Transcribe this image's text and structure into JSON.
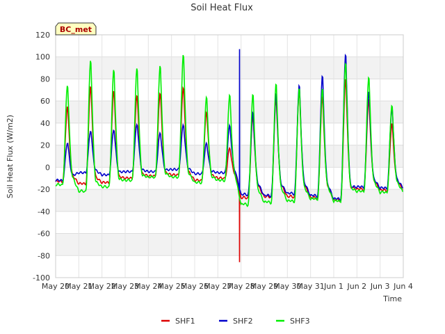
{
  "chart_data": {
    "type": "line",
    "title": "Soil Heat Flux",
    "xlabel": "Time",
    "ylabel": "Soil Heat Flux (W/m2)",
    "badge": "BC_met",
    "ylim": [
      -100,
      120
    ],
    "yticks": [
      -100,
      -80,
      -60,
      -40,
      -20,
      0,
      20,
      40,
      60,
      80,
      100,
      120
    ],
    "xlim": [
      0,
      15
    ],
    "xticks": [
      {
        "v": 0,
        "label": "May 20"
      },
      {
        "v": 1,
        "label": "May 21"
      },
      {
        "v": 2,
        "label": "May 22"
      },
      {
        "v": 3,
        "label": "May 23"
      },
      {
        "v": 4,
        "label": "May 24"
      },
      {
        "v": 5,
        "label": "May 25"
      },
      {
        "v": 6,
        "label": "May 26"
      },
      {
        "v": 7,
        "label": "May 27"
      },
      {
        "v": 8,
        "label": "May 28"
      },
      {
        "v": 9,
        "label": "May 29"
      },
      {
        "v": 10,
        "label": "May 30"
      },
      {
        "v": 11,
        "label": "May 31"
      },
      {
        "v": 12,
        "label": "Jun 1"
      },
      {
        "v": 13,
        "label": "Jun 2"
      },
      {
        "v": 14,
        "label": "Jun 3"
      },
      {
        "v": 15,
        "label": "Jun 4"
      }
    ],
    "grid": true,
    "legend_position": "bottom",
    "series": [
      {
        "name": "SHF1",
        "color": "#dd0000",
        "days": [
          {
            "min": -13,
            "peak": 56
          },
          {
            "min": -15,
            "peak": 75
          },
          {
            "min": -14,
            "peak": 71
          },
          {
            "min": -10,
            "peak": 67
          },
          {
            "min": -8,
            "peak": 69
          },
          {
            "min": -7,
            "peak": 74
          },
          {
            "min": -12,
            "peak": 51
          },
          {
            "min": -10,
            "peak": 18
          },
          {
            "min": -28,
            "peak": 47
          },
          {
            "min": -27,
            "peak": 63
          },
          {
            "min": -27,
            "peak": 71
          },
          {
            "min": -28,
            "peak": 65
          },
          {
            "min": -30,
            "peak": 81
          },
          {
            "min": -20,
            "peak": 62
          },
          {
            "min": -21,
            "peak": 40
          }
        ],
        "spike": {
          "x": 7.93,
          "y": -86
        }
      },
      {
        "name": "SHF2",
        "color": "#0000cc",
        "days": [
          {
            "min": -12,
            "peak": 23
          },
          {
            "min": -5,
            "peak": 34
          },
          {
            "min": -7,
            "peak": 35
          },
          {
            "min": -4,
            "peak": 40
          },
          {
            "min": -4,
            "peak": 32
          },
          {
            "min": -2,
            "peak": 39
          },
          {
            "min": -6,
            "peak": 22
          },
          {
            "min": -5,
            "peak": 38
          },
          {
            "min": -25,
            "peak": 50
          },
          {
            "min": -26,
            "peak": 67
          },
          {
            "min": -24,
            "peak": 75
          },
          {
            "min": -26,
            "peak": 84
          },
          {
            "min": -29,
            "peak": 104
          },
          {
            "min": -18,
            "peak": 70
          },
          {
            "min": -19,
            "peak": 55
          }
        ],
        "spike": {
          "x": 7.93,
          "y": 107
        }
      },
      {
        "name": "SHF3",
        "color": "#00ee00",
        "days": [
          {
            "min": -16,
            "peak": 76
          },
          {
            "min": -22,
            "peak": 99
          },
          {
            "min": -18,
            "peak": 90
          },
          {
            "min": -12,
            "peak": 91
          },
          {
            "min": -9,
            "peak": 93
          },
          {
            "min": -9,
            "peak": 103
          },
          {
            "min": -14,
            "peak": 64
          },
          {
            "min": -12,
            "peak": 66
          },
          {
            "min": -34,
            "peak": 67
          },
          {
            "min": -32,
            "peak": 77
          },
          {
            "min": -31,
            "peak": 73
          },
          {
            "min": -29,
            "peak": 73
          },
          {
            "min": -31,
            "peak": 97
          },
          {
            "min": -22,
            "peak": 84
          },
          {
            "min": -23,
            "peak": 58
          }
        ]
      }
    ]
  }
}
